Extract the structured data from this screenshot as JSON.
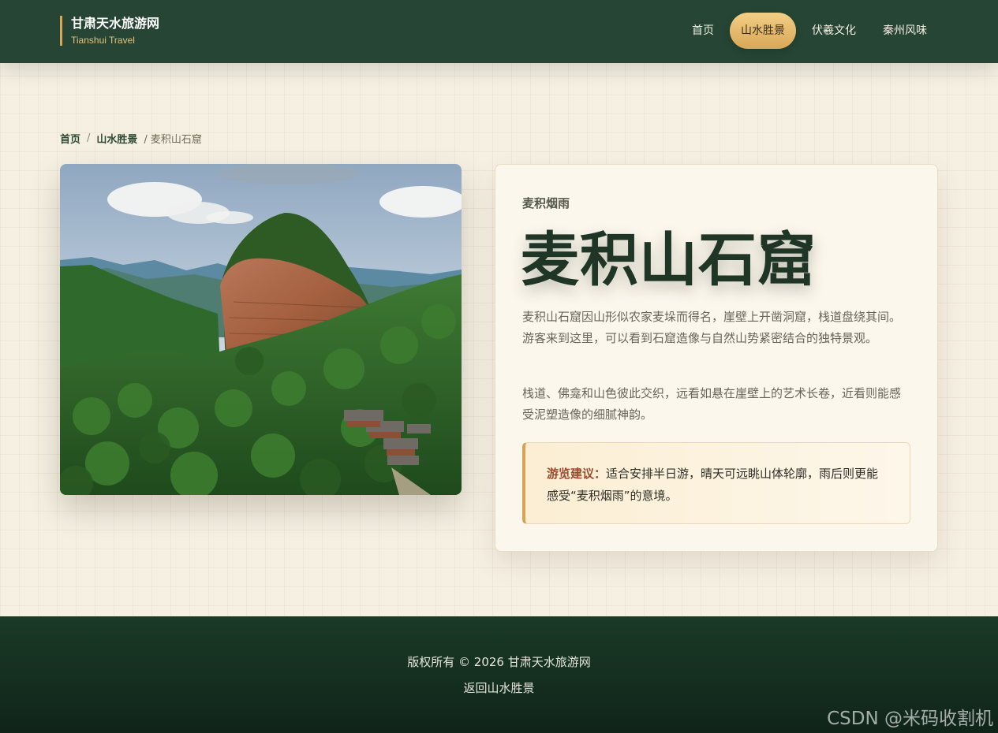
{
  "header": {
    "brand_title": "甘肃天水旅游网",
    "brand_subtitle": "Tianshui Travel",
    "nav": [
      {
        "label": "首页",
        "active": false
      },
      {
        "label": "山水胜景",
        "active": true
      },
      {
        "label": "伏羲文化",
        "active": false
      },
      {
        "label": "秦州风味",
        "active": false
      }
    ]
  },
  "breadcrumb": {
    "home": "首页",
    "sep1": "/",
    "section": "山水胜景",
    "current": "/ 麦积山石窟"
  },
  "photo": {
    "subject": "麦积山石窟 aerial view: red cliff rising from forested hills with temple roofs"
  },
  "info": {
    "eyebrow": "麦积烟雨",
    "title": "麦积山石窟",
    "paragraph1": "麦积山石窟因山形似农家麦垛而得名，崖壁上开凿洞窟，栈道盘绕其间。游客来到这里，可以看到石窟造像与自然山势紧密结合的独特景观。",
    "paragraph2": "栈道、佛龛和山色彼此交织，远看如悬在崖壁上的艺术长卷，近看则能感受泥塑造像的细腻神韵。",
    "tip_label": "游览建议：",
    "tip_text": "适合安排半日游，晴天可远眺山体轮廓，雨后则更能感受“麦积烟雨”的意境。"
  },
  "footer": {
    "copyright": "版权所有 © 2026 甘肃天水旅游网",
    "back_link": "返回山水胜景",
    "watermark": "CSDN @米码收割机"
  },
  "colors": {
    "header_bg": "#264534",
    "accent_gold": "#d9a757",
    "page_bg": "#f6f0e3",
    "title_green": "#1f3626",
    "tip_label": "#9b4a30"
  }
}
